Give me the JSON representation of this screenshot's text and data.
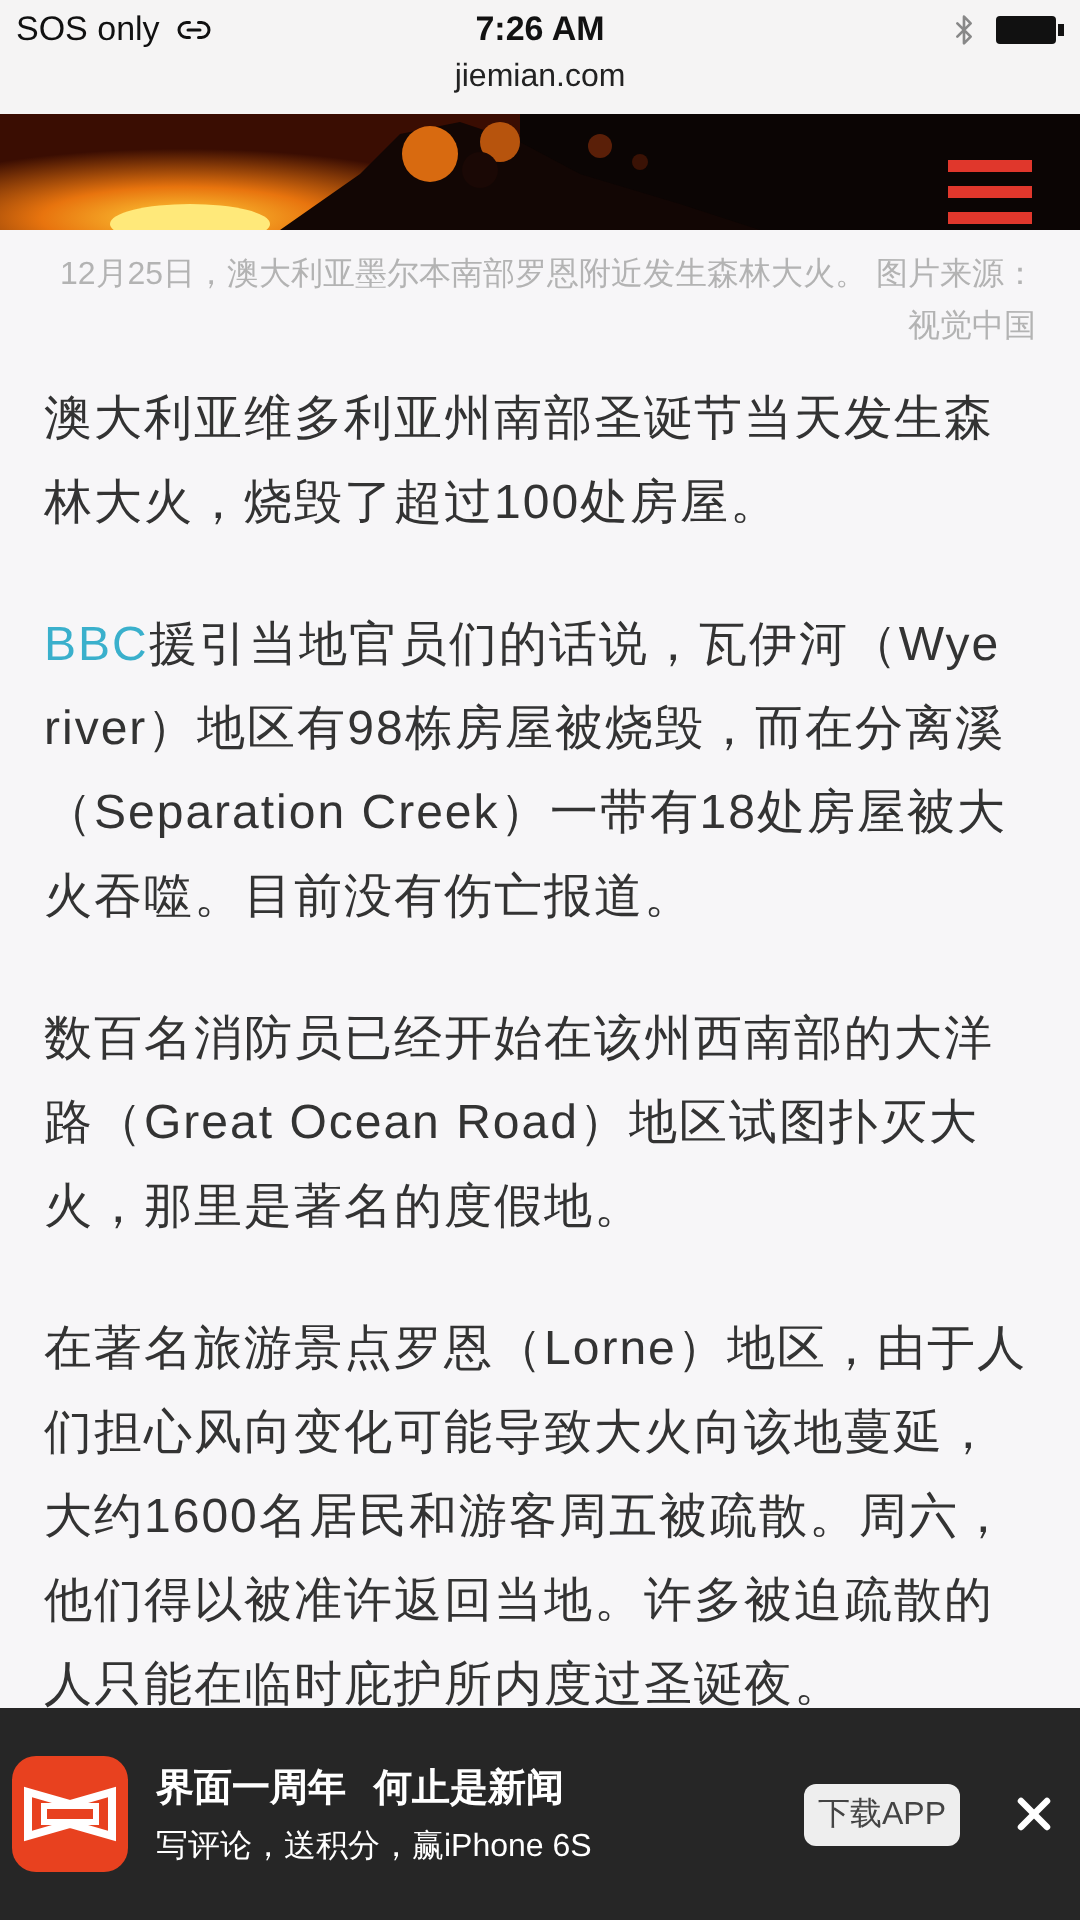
{
  "status_bar": {
    "carrier": "SOS only",
    "time": "7:26 AM"
  },
  "address_bar": {
    "url": "jiemian.com"
  },
  "hero": {
    "menu_button": true
  },
  "caption": "12月25日，澳大利亚墨尔本南部罗恩附近发生森林大火。 图片来源：视觉中国",
  "paragraphs": [
    {
      "text": "澳大利亚维多利亚州南部圣诞节当天发生森林大火，烧毁了超过100处房屋。"
    },
    {
      "link": "BBC",
      "text": "援引当地官员们的话说，瓦伊河（Wye river）地区有98栋房屋被烧毁，而在分离溪（Separation Creek）一带有18处房屋被大火吞噬。目前没有伤亡报道。"
    },
    {
      "text": "数百名消防员已经开始在该州西南部的大洋路（Great Ocean Road）地区试图扑灭大火，那里是著名的度假地。"
    },
    {
      "text": "在著名旅游景点罗恩（Lorne）地区，由于人们担心风向变化可能导致大火向该地蔓延，大约1600名居民和游客周五被疏散。周六，他们得以被准许返回当地。许多被迫疏散的人只能在临时庇护所内度过圣诞夜。"
    }
  ],
  "banner": {
    "title": [
      "界面一周年",
      "何止是新闻"
    ],
    "subtitle": "写评论，送积分，赢iPhone 6S",
    "button": "下载APP"
  }
}
